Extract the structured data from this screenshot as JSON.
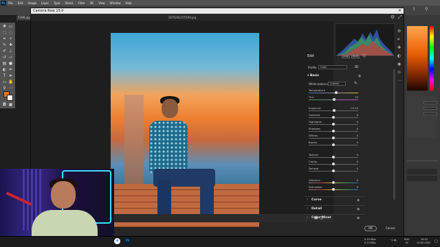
{
  "photoshop": {
    "logo": "Ps",
    "menu": [
      "File",
      "Edit",
      "Image",
      "Layer",
      "Type",
      "Select",
      "Filter",
      "3D",
      "View",
      "Window",
      "Help"
    ],
    "doc_tab": "5298.jpg"
  },
  "camera_raw": {
    "title": "Camera Raw 15.0",
    "filename": "1676281255599.jpg",
    "edit": {
      "header": "Edit",
      "auto_label": "Auto",
      "bw_label": "B&W",
      "profile_label": "Profile",
      "profile_value": "Color",
      "basic_section": "Basic",
      "white_balance_label": "White balance",
      "white_balance_value": "Custom",
      "sliders": [
        {
          "label": "Temperature",
          "value": "",
          "pos": 0.55
        },
        {
          "label": "Tint",
          "value": "10",
          "pos": 0.52
        },
        {
          "label": "Exposure",
          "value": "+0.10",
          "pos": 0.52
        },
        {
          "label": "Contrast",
          "value": "0",
          "pos": 0.5
        },
        {
          "label": "Highlights",
          "value": "0",
          "pos": 0.5
        },
        {
          "label": "Shadows",
          "value": "0",
          "pos": 0.5
        },
        {
          "label": "Whites",
          "value": "0",
          "pos": 0.5
        },
        {
          "label": "Blacks",
          "value": "0",
          "pos": 0.5
        },
        {
          "label": "Texture",
          "value": "0",
          "pos": 0.5
        },
        {
          "label": "Clarity",
          "value": "0",
          "pos": 0.5
        },
        {
          "label": "Dehaze",
          "value": "0",
          "pos": 0.5
        },
        {
          "label": "Vibrance",
          "value": "0",
          "pos": 0.5
        },
        {
          "label": "Saturation",
          "value": "0",
          "pos": 0.5
        }
      ],
      "collapsed_sections": [
        "Curve",
        "Detail",
        "Color Mixer"
      ]
    },
    "ok_label": "OK",
    "cancel_label": "Cancel"
  },
  "taskbar": {
    "net_up": "0.20 KB/s",
    "net_down": "0.13 KB/s",
    "lang": "ENG",
    "lang2": "IN",
    "time": "16:15",
    "date": "13-02-2023"
  },
  "colors": {
    "foreground": "#e8751a",
    "background": "#ffffff"
  }
}
